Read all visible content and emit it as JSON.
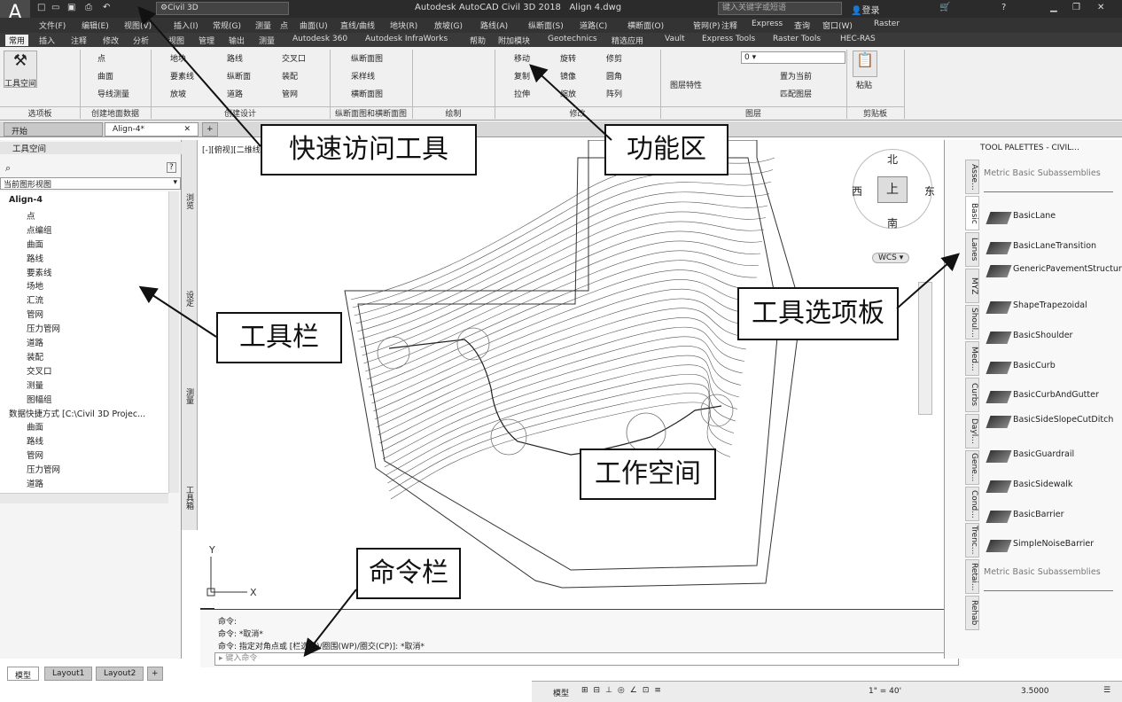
{
  "title_bar": {
    "app_name": "Autodesk AutoCAD Civil 3D 2018",
    "file_name": "Align 4.dwg",
    "workspace": "Civil 3D",
    "search_placeholder": "键入关键字或短语",
    "sign_in": "登录"
  },
  "menu": [
    "文件(F)",
    "编辑(E)",
    "视图(V)",
    "插入(I)",
    "常规(G)",
    "测量",
    "点",
    "曲面(U)",
    "直线/曲线",
    "地块(R)",
    "放坡(G)",
    "路线(A)",
    "纵断面(S)",
    "道路(C)",
    "横断面(O)",
    "管网(P)",
    "注释",
    "Express",
    "查询",
    "窗口(W)",
    "Raster"
  ],
  "ribbon_tabs": [
    "常用",
    "插入",
    "注释",
    "修改",
    "分析",
    "视图",
    "管理",
    "输出",
    "测量",
    "Autodesk 360",
    "Autodesk InfraWorks",
    "帮助",
    "附加模块",
    "Geotechnics",
    "精选应用",
    "Vault",
    "Express Tools",
    "Raster Tools",
    "HEC-RAS"
  ],
  "ribbon": {
    "workspace_btn": "工具空间",
    "col1": [
      "点",
      "曲面",
      "导线测量"
    ],
    "col2": [
      "地块",
      "要素线",
      "放坡"
    ],
    "col3": [
      "路线",
      "纵断面",
      "道路"
    ],
    "col4": [
      "交叉口",
      "装配",
      "管网"
    ],
    "col5": [
      "纵断面图",
      "采样线",
      "横断面图"
    ],
    "modify": [
      "移动",
      "旋转",
      "修剪",
      "复制",
      "镜像",
      "圆角",
      "拉伸",
      "缩放",
      "阵列"
    ],
    "layers": [
      "图层特性",
      "置为当前",
      "匹配图层"
    ],
    "layer_value": "0",
    "paste": "粘贴",
    "panels": [
      "选项板",
      "创建地面数据",
      "创建设计",
      "纵断面图和横断面图",
      "绘制",
      "修改",
      "图层",
      "剪贴板"
    ]
  },
  "doc_tabs": [
    "开始",
    "Align-4*"
  ],
  "toolspace": {
    "title": "工具空间",
    "view": "当前图形视图",
    "tree": [
      {
        "label": "Align-4",
        "level": 0,
        "bold": true
      },
      {
        "label": "点",
        "level": 1
      },
      {
        "label": "点编组",
        "level": 1
      },
      {
        "label": "曲面",
        "level": 1
      },
      {
        "label": "路线",
        "level": 1
      },
      {
        "label": "要素线",
        "level": 1
      },
      {
        "label": "场地",
        "level": 1
      },
      {
        "label": "汇流",
        "level": 1
      },
      {
        "label": "管网",
        "level": 1
      },
      {
        "label": "压力管网",
        "level": 1
      },
      {
        "label": "道路",
        "level": 1
      },
      {
        "label": "装配",
        "level": 1
      },
      {
        "label": "交叉口",
        "level": 1
      },
      {
        "label": "测量",
        "level": 1
      },
      {
        "label": "图幅组",
        "level": 1
      },
      {
        "label": "数据快捷方式 [C:\\Civil 3D Projec...",
        "level": 0
      },
      {
        "label": "曲面",
        "level": 1
      },
      {
        "label": "路线",
        "level": 1
      },
      {
        "label": "管网",
        "level": 1
      },
      {
        "label": "压力管网",
        "level": 1
      },
      {
        "label": "道路",
        "level": 1
      },
      {
        "label": "图幅组",
        "level": 1
      }
    ],
    "vertical_tabs": [
      "浏览",
      "设定",
      "测量",
      "工具箱"
    ]
  },
  "viewport_label": "[-][俯视][二维线框]",
  "viewcube": {
    "north": "北",
    "south": "南",
    "east": "东",
    "west": "西",
    "top": "上",
    "wcs": "WCS"
  },
  "ucs": {
    "x": "X",
    "y": "Y"
  },
  "command": {
    "lines": [
      "命令:",
      "命令: *取消*",
      "命令: 指定对角点或 [栏选(F)/圈围(WP)/圈交(CP)]: *取消*"
    ],
    "placeholder": "键入命令"
  },
  "tool_palette": {
    "title": "TOOL PALETTES - CIVIL...",
    "header": "Metric Basic Subassemblies",
    "footer": "Metric Basic Subassemblies",
    "items": [
      "BasicLane",
      "BasicLaneTransition",
      "GenericPavementStructure",
      "ShapeTrapezoidal",
      "BasicShoulder",
      "BasicCurb",
      "BasicCurbAndGutter",
      "BasicSideSlopeCutDitch",
      "BasicGuardrail",
      "BasicSidewalk",
      "BasicBarrier",
      "SimpleNoiseBarrier"
    ],
    "tabs": [
      "Asse...",
      "Basic",
      "Lanes",
      "MYZ",
      "Shoul...",
      "Med...",
      "Curbs",
      "Dayl...",
      "Gene...",
      "Cond...",
      "Trenc...",
      "Retai...",
      "Rehab"
    ]
  },
  "layout_tabs": [
    "模型",
    "Layout1",
    "Layout2"
  ],
  "status": {
    "model": "模型",
    "scale": "1\" = 40'",
    "value": "3.5000"
  },
  "callouts": {
    "quick_access": "快速访问工具",
    "ribbon": "功能区",
    "toolbar": "工具栏",
    "tool_palette": "工具选项板",
    "workspace": "工作空间",
    "command": "命令栏"
  }
}
